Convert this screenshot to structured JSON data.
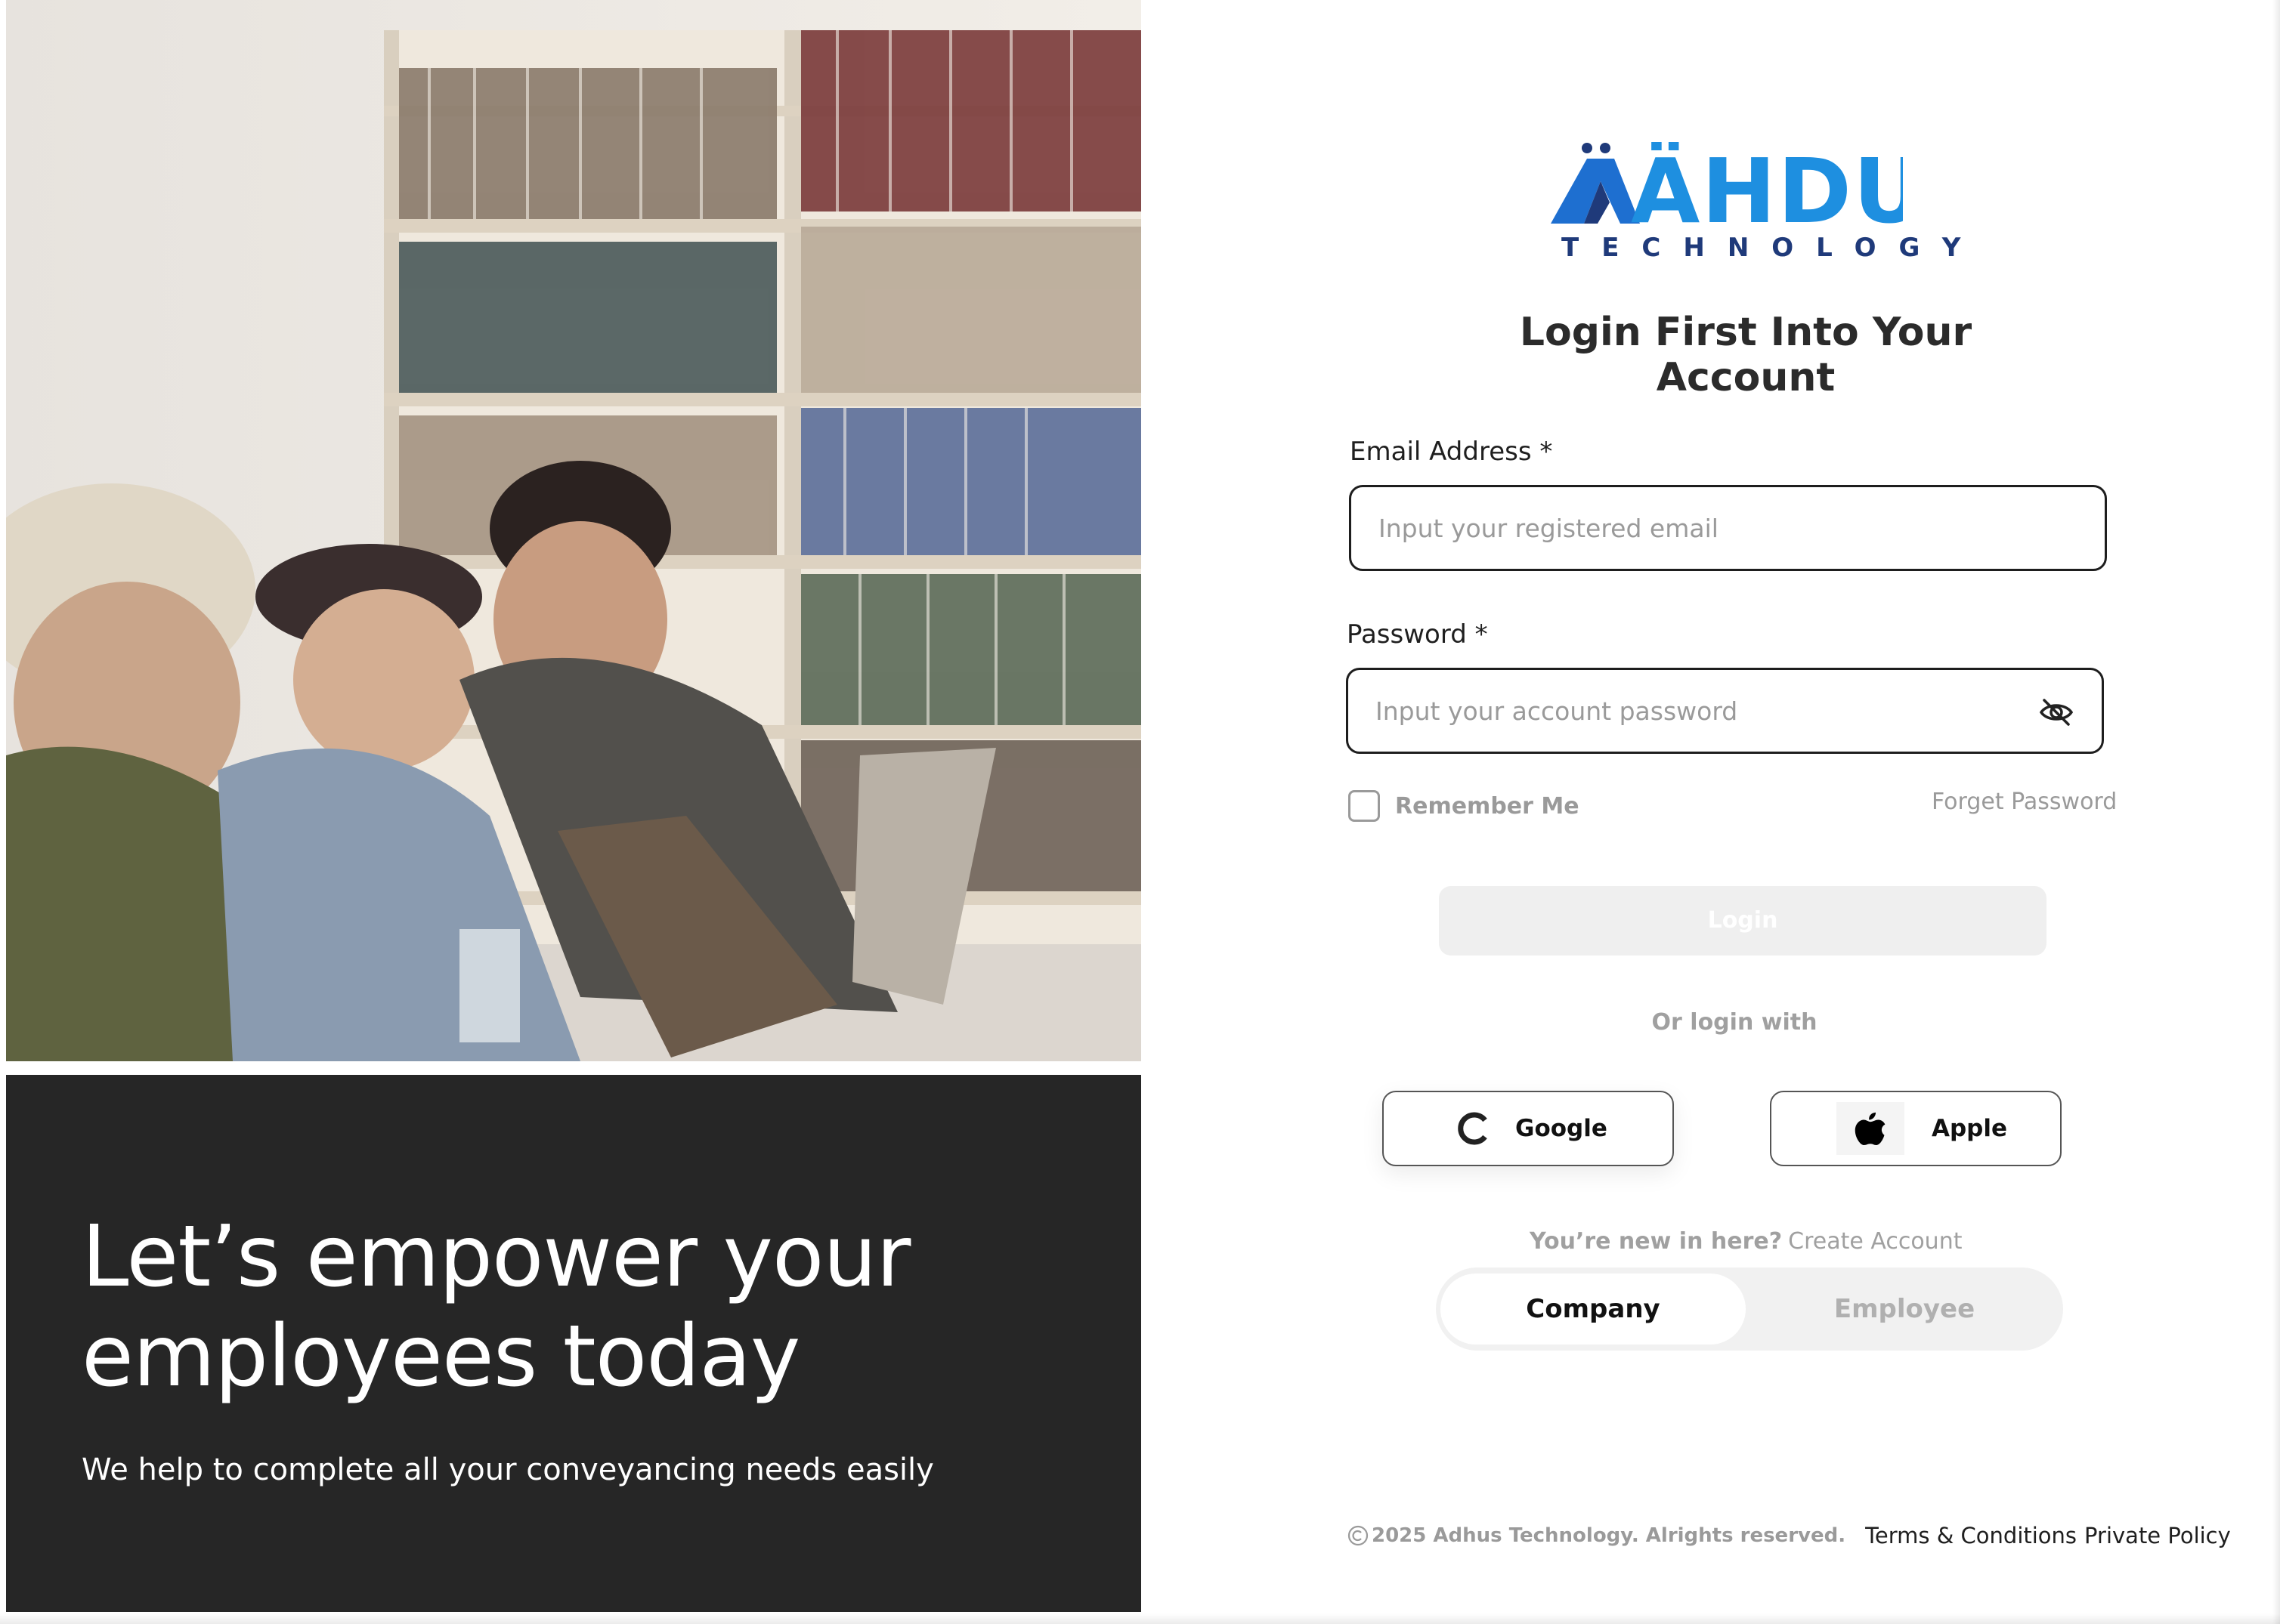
{
  "hero": {
    "title_line1": "Let’s empower your",
    "title_line2": "employees today",
    "subtitle": "We help to complete all your conveyancing needs easily"
  },
  "brand": {
    "logo_text": "ÄHDUS",
    "logo_subtext": "TECHNOLOGY",
    "primary_color": "#1e8fe0",
    "dark_color": "#1f3a7a"
  },
  "form": {
    "title": "Login First Into Your Account",
    "email_label": "Email Address *",
    "email_placeholder": "Input your registered email",
    "email_value": "",
    "password_label": "Password *",
    "password_placeholder": "Input your account password",
    "password_value": "",
    "password_toggle_icon": "eye-off-icon",
    "remember_label": "Remember Me",
    "remember_checked": false,
    "forget_label": "Forget Password",
    "login_label": "Login",
    "login_enabled": false
  },
  "social": {
    "divider_text": "Or login with",
    "google_label": "Google",
    "apple_label": "Apple"
  },
  "signup": {
    "question": "You’re new in here?",
    "link": "Create Account",
    "options": [
      "Company",
      "Employee"
    ],
    "selected": "Company"
  },
  "footer": {
    "copyright": "2025 Adhus Technology. Alrights reserved.",
    "terms": "Terms & Conditions",
    "privacy": "Private Policy"
  }
}
